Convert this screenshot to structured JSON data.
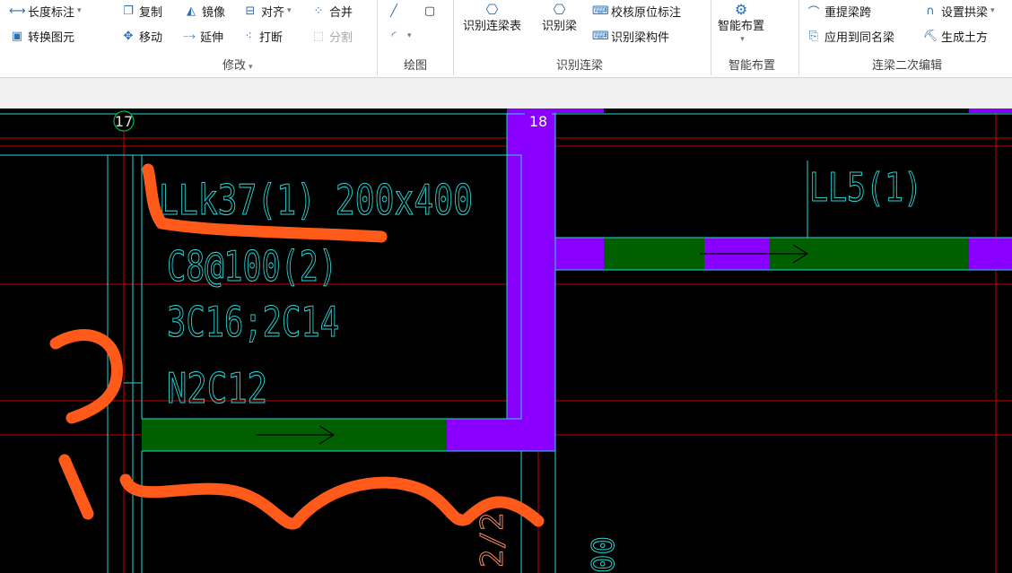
{
  "ribbon": {
    "modify": {
      "length_dim": "长度标注",
      "convert": "转换图元",
      "copy": "复制",
      "mirror": "镜像",
      "align": "对齐",
      "merge": "合并",
      "move": "移动",
      "extend": "延伸",
      "break": "打断",
      "split": "分割",
      "group_label": "修改"
    },
    "draw": {
      "group_label": "绘图"
    },
    "identify": {
      "table": "识别连梁表",
      "beam": "识别梁",
      "check_label": "校核原位标注",
      "component": "识别梁构件",
      "group_label": "识别连梁"
    },
    "smart": {
      "layout": "智能布置",
      "group_label": "智能布置"
    },
    "secondary": {
      "re_extract": "重提梁跨",
      "arch": "设置拱梁",
      "apply_same": "应用到同名梁",
      "earth": "生成土方",
      "group_label": "连梁二次编辑"
    }
  },
  "cad": {
    "axis_17": "17",
    "axis_18": "18",
    "beam_name": "LLk37(1) 200x400",
    "stirrup": "C8@100(2)",
    "rebar": "3C16;2C14",
    "side_rebar": "N2C12",
    "beam2_name": "LL5(1)",
    "bottom_text": "2/2",
    "right_text": "00",
    "colors": {
      "background": "#000000",
      "cyan": "#2ad4d4",
      "red_grid": "#c80000",
      "purple": "#8a00ff",
      "green_beam": "#006000",
      "orange_mark": "#ff5a1a"
    }
  }
}
